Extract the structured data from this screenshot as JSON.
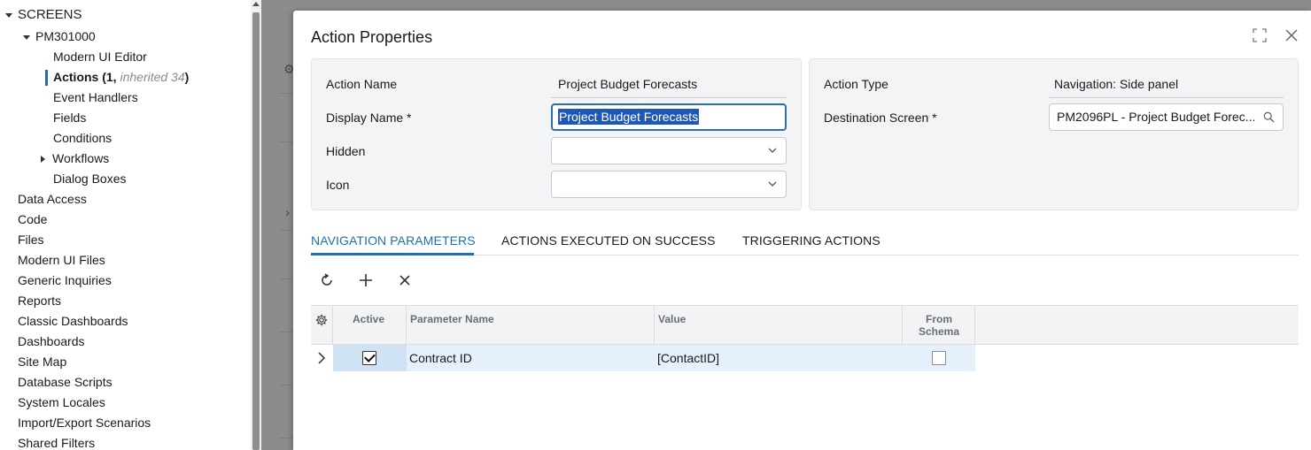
{
  "tree": {
    "root_label": "SCREENS",
    "screen_id": "PM301000",
    "children": [
      {
        "label": "Modern UI Editor"
      },
      {
        "label": "Actions (1, ",
        "inherited": "inherited 34",
        "suffix": ")"
      },
      {
        "label": "Event Handlers"
      },
      {
        "label": "Fields"
      },
      {
        "label": "Conditions"
      },
      {
        "label": "Workflows"
      },
      {
        "label": "Dialog Boxes"
      }
    ],
    "sections": [
      "Data Access",
      "Code",
      "Files",
      "Modern UI Files",
      "Generic Inquiries",
      "Reports",
      "Classic Dashboards",
      "Dashboards",
      "Site Map",
      "Database Scripts",
      "System Locales",
      "Import/Export Scenarios",
      "Shared Filters"
    ]
  },
  "modal": {
    "title": "Action Properties",
    "left": {
      "action_name_label": "Action Name",
      "action_name_value": "Project Budget Forecasts",
      "display_name_label": "Display Name *",
      "display_name_value": "Project Budget Forecasts",
      "hidden_label": "Hidden",
      "hidden_value": "",
      "icon_label": "Icon",
      "icon_value": ""
    },
    "right": {
      "action_type_label": "Action Type",
      "action_type_value": "Navigation: Side panel",
      "destination_label": "Destination Screen *",
      "destination_value": "PM2096PL - Project Budget Forec..."
    },
    "tabs": [
      {
        "label": "NAVIGATION PARAMETERS",
        "active": true
      },
      {
        "label": "ACTIONS EXECUTED ON SUCCESS",
        "active": false
      },
      {
        "label": "TRIGGERING ACTIONS",
        "active": false
      }
    ],
    "grid": {
      "headers": {
        "active": "Active",
        "parameter_name": "Parameter Name",
        "value": "Value",
        "from_schema_1": "From",
        "from_schema_2": "Schema"
      },
      "rows": [
        {
          "active": true,
          "parameter_name": "Contract ID",
          "value": "[ContactID]",
          "from_schema": false
        }
      ]
    }
  },
  "colors": {
    "accent": "#1f6fb3",
    "selection": "#1f57b8",
    "row_selected": "#e5f0fa"
  }
}
